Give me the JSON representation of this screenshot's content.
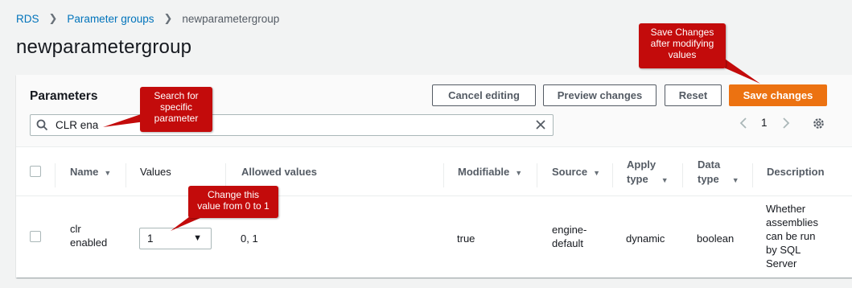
{
  "breadcrumb": {
    "rds": "RDS",
    "parameter_groups": "Parameter groups",
    "current": "newparametergroup"
  },
  "page_title": "newparametergroup",
  "panel": {
    "title": "Parameters",
    "buttons": {
      "cancel": "Cancel editing",
      "preview": "Preview changes",
      "reset": "Reset",
      "save": "Save changes"
    },
    "search_value": "CLR ena",
    "pagination": {
      "page": "1"
    }
  },
  "table": {
    "headers": {
      "name": "Name",
      "values": "Values",
      "allowed": "Allowed values",
      "modifiable": "Modifiable",
      "source": "Source",
      "apply_type_1": "Apply",
      "apply_type_2": "type",
      "data_type_1": "Data",
      "data_type_2": "type",
      "description": "Description"
    },
    "row": {
      "name_1": "clr",
      "name_2": "enabled",
      "value": "1",
      "allowed": "0, 1",
      "modifiable": "true",
      "source_1": "engine-",
      "source_2": "default",
      "apply_type": "dynamic",
      "data_type": "boolean",
      "desc_1": "Whether",
      "desc_2": "assemblies",
      "desc_3": "can be run",
      "desc_4": "by SQL",
      "desc_5": "Server"
    }
  },
  "callouts": {
    "search_1": "Search for",
    "search_2": "specific",
    "search_3": "parameter",
    "save_1": "Save Changes",
    "save_2": "after modifying",
    "save_3": "values",
    "change_1": "Change this",
    "change_2": "value from 0 to 1"
  },
  "colors": {
    "primary": "#ec7211",
    "link": "#0073bb",
    "callout": "#c30b0b"
  }
}
